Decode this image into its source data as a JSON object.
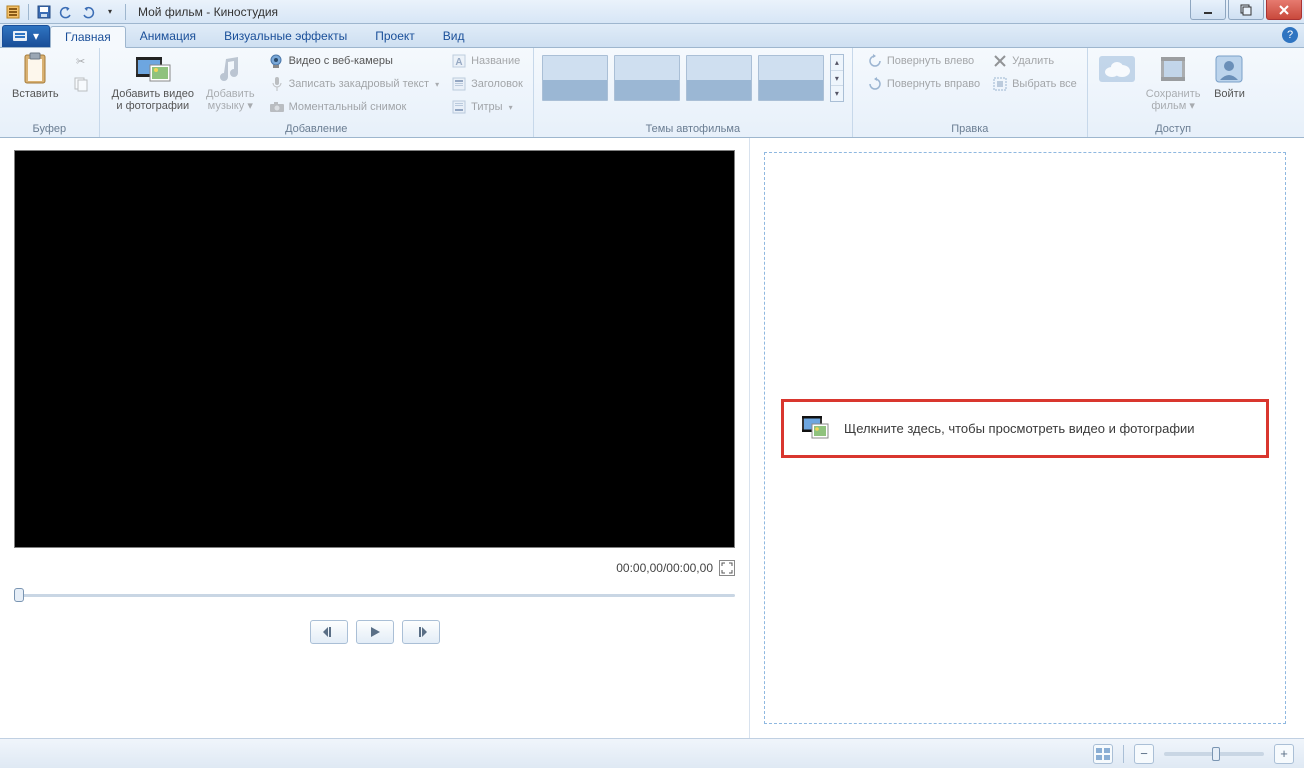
{
  "window": {
    "title": "Мой фильм - Киностудия"
  },
  "tabs": {
    "file_symbol": "▾",
    "items": [
      "Главная",
      "Анимация",
      "Визуальные эффекты",
      "Проект",
      "Вид"
    ],
    "active_index": 0,
    "help_symbol": "?"
  },
  "ribbon": {
    "groups": {
      "buffer": {
        "title": "Буфер",
        "paste": "Вставить"
      },
      "add": {
        "title": "Добавление",
        "add_video_photo_line1": "Добавить видео",
        "add_video_photo_line2": "и фотографии",
        "add_music_line1": "Добавить",
        "add_music_line2": "музыку",
        "webcam": "Видео с веб-камеры",
        "narration": "Записать закадровый текст",
        "snapshot": "Моментальный снимок",
        "caption": "Название",
        "header": "Заголовок",
        "titles": "Титры"
      },
      "themes": {
        "title": "Темы автофильма"
      },
      "edit": {
        "title": "Правка",
        "rotate_left": "Повернуть влево",
        "rotate_right": "Повернуть вправо",
        "delete": "Удалить",
        "select_all": "Выбрать все"
      },
      "access": {
        "title": "Доступ",
        "save_movie_line1": "Сохранить",
        "save_movie_line2": "фильм",
        "signin": "Войти"
      }
    }
  },
  "preview": {
    "time": "00:00,00/00:00,00"
  },
  "timeline": {
    "prompt": "Щелкните здесь, чтобы просмотреть видео и фотографии"
  }
}
